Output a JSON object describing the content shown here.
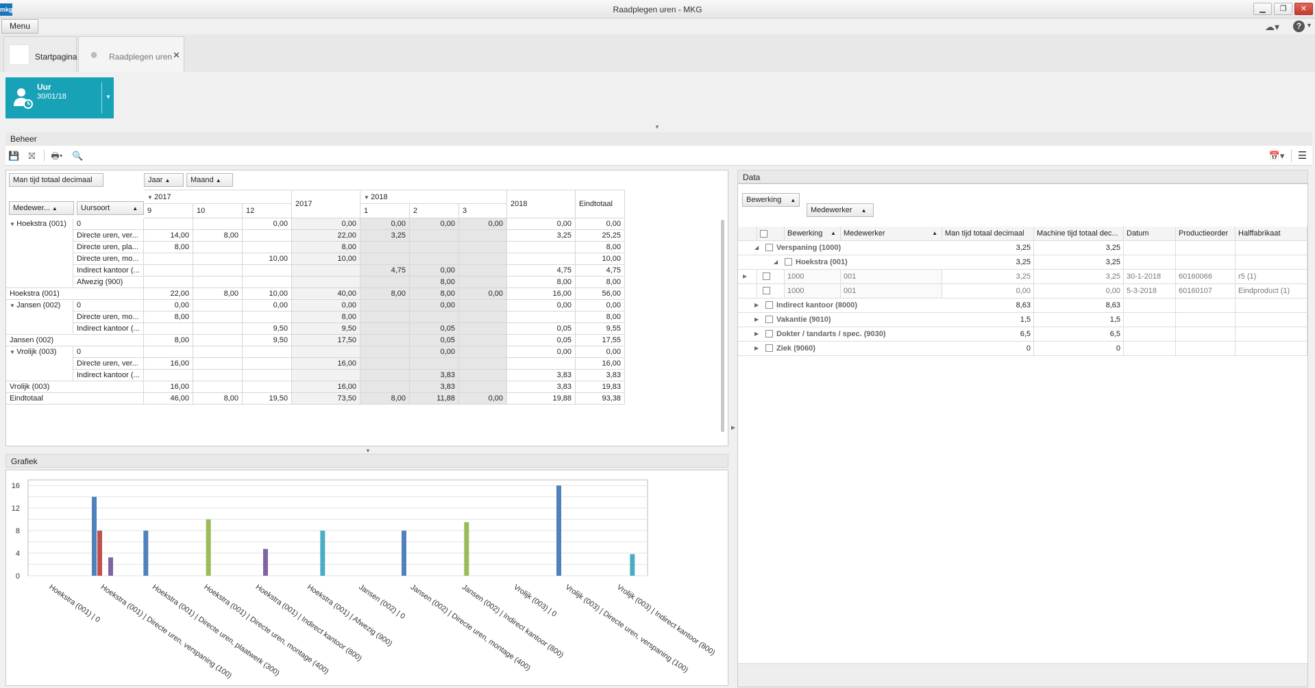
{
  "window": {
    "title": "Raadplegen uren - MKG",
    "logo": "mkg",
    "menu_label": "Menu"
  },
  "tabs": [
    {
      "label": "Startpagina",
      "closable": false
    },
    {
      "label": "Raadplegen uren",
      "closable": true
    }
  ],
  "tile": {
    "title": "Uur",
    "date": "30/01/18",
    "accent": "#17a2b8"
  },
  "beheer": {
    "title": "Beheer"
  },
  "pivot": {
    "data_field": "Man tijd totaal decimaal",
    "col_fields": [
      "Jaar",
      "Maand"
    ],
    "row_fields": [
      "Medewer...",
      "Uursoort"
    ],
    "col_headers": {
      "y2017": "2017",
      "m9": "9",
      "m10": "10",
      "m12": "12",
      "t2017": "2017",
      "y2018": "2018",
      "m1": "1",
      "m2": "2",
      "m3": "3",
      "t2018": "2018",
      "total": "Eindtotaal"
    },
    "rows": [
      {
        "group": "Hoekstra (001)",
        "type": "0",
        "v": [
          "",
          "",
          "0,00",
          "0,00",
          "0,00",
          "0,00",
          "0,00",
          "0,00",
          "0,00"
        ]
      },
      {
        "group": "",
        "type": "Directe uren, ver...",
        "v": [
          "14,00",
          "8,00",
          "",
          "22,00",
          "3,25",
          "",
          "",
          "3,25",
          "25,25"
        ]
      },
      {
        "group": "",
        "type": "Directe uren, pla...",
        "v": [
          "8,00",
          "",
          "",
          "8,00",
          "",
          "",
          "",
          "",
          "8,00"
        ]
      },
      {
        "group": "",
        "type": "Directe uren, mo...",
        "v": [
          "",
          "",
          "10,00",
          "10,00",
          "",
          "",
          "",
          "",
          "10,00"
        ]
      },
      {
        "group": "",
        "type": "Indirect kantoor (...",
        "v": [
          "",
          "",
          "",
          "",
          "4,75",
          "0,00",
          "",
          "4,75",
          "4,75"
        ]
      },
      {
        "group": "",
        "type": "Afwezig (900)",
        "v": [
          "",
          "",
          "",
          "",
          "",
          "8,00",
          "",
          "8,00",
          "8,00"
        ]
      },
      {
        "total": "Hoekstra (001)",
        "v": [
          "22,00",
          "8,00",
          "10,00",
          "40,00",
          "8,00",
          "8,00",
          "0,00",
          "16,00",
          "56,00"
        ]
      },
      {
        "group": "Jansen (002)",
        "type": "0",
        "v": [
          "0,00",
          "",
          "0,00",
          "0,00",
          "",
          "0,00",
          "",
          "0,00",
          "0,00"
        ]
      },
      {
        "group": "",
        "type": "Directe uren, mo...",
        "v": [
          "8,00",
          "",
          "",
          "8,00",
          "",
          "",
          "",
          "",
          "8,00"
        ]
      },
      {
        "group": "",
        "type": "Indirect kantoor (...",
        "v": [
          "",
          "",
          "9,50",
          "9,50",
          "",
          "0,05",
          "",
          "0,05",
          "9,55"
        ]
      },
      {
        "total": "Jansen (002)",
        "v": [
          "8,00",
          "",
          "9,50",
          "17,50",
          "",
          "0,05",
          "",
          "0,05",
          "17,55"
        ]
      },
      {
        "group": "Vrolijk (003)",
        "type": "0",
        "v": [
          "",
          "",
          "",
          "",
          "",
          "0,00",
          "",
          "0,00",
          "0,00"
        ]
      },
      {
        "group": "",
        "type": "Directe uren, ver...",
        "v": [
          "16,00",
          "",
          "",
          "16,00",
          "",
          "",
          "",
          "",
          "16,00"
        ]
      },
      {
        "group": "",
        "type": "Indirect kantoor (...",
        "v": [
          "",
          "",
          "",
          "",
          "",
          "3,83",
          "",
          "3,83",
          "3,83"
        ]
      },
      {
        "total": "Vrolijk (003)",
        "v": [
          "16,00",
          "",
          "",
          "16,00",
          "",
          "3,83",
          "",
          "3,83",
          "19,83"
        ]
      },
      {
        "total": "Eindtotaal",
        "v": [
          "46,00",
          "8,00",
          "19,50",
          "73,50",
          "8,00",
          "11,88",
          "0,00",
          "19,88",
          "93,38"
        ]
      }
    ]
  },
  "grafiek": {
    "title": "Grafiek"
  },
  "chart_data": {
    "type": "bar",
    "title": "",
    "xlabel": "",
    "ylabel": "",
    "ylim": [
      0,
      17
    ],
    "yticks": [
      0,
      4,
      8,
      12,
      16
    ],
    "grid": true,
    "categories": [
      "Hoekstra (001) | 0",
      "Hoekstra (001) | Directe uren, verspaning (100)",
      "Hoekstra (001) | Directe uren, plaatwerk (300)",
      "Hoekstra (001) | Directe uren, montage (400)",
      "Hoekstra (001) | Indirect kantoor (800)",
      "Hoekstra (001) | Afwezig (900)",
      "Jansen (002) | 0",
      "Jansen (002) | Directe uren, montage (400)",
      "Jansen (002) | Indirect kantoor (800)",
      "Vrolijk (003) | 0",
      "Vrolijk (003) | Directe uren, verspaning (100)",
      "Vrolijk (003) | Indirect kantoor (800)"
    ],
    "series": [
      {
        "color": "#4f81bd",
        "values": [
          0,
          14,
          8,
          0,
          0,
          0,
          0,
          8,
          0,
          0,
          16,
          0
        ]
      },
      {
        "color": "#c0504d",
        "values": [
          0,
          8,
          0,
          0,
          0,
          0,
          0,
          0,
          0,
          0,
          0,
          0
        ]
      },
      {
        "color": "#9bbb59",
        "values": [
          0,
          0,
          0,
          10,
          0,
          0,
          0,
          0,
          9.5,
          0,
          0,
          0
        ]
      },
      {
        "color": "#8064a2",
        "values": [
          0,
          3.25,
          0,
          0,
          4.75,
          0,
          0,
          0,
          0,
          0,
          0,
          0
        ]
      },
      {
        "color": "#4bacc6",
        "values": [
          0,
          0,
          0,
          0,
          0,
          8,
          0,
          0,
          0,
          0,
          0,
          3.83
        ]
      }
    ]
  },
  "datapanel": {
    "title": "Data",
    "group_fields": [
      "Bewerking",
      "Medewerker"
    ],
    "columns": [
      "Bewerking",
      "Medewerker",
      "Man tijd totaal decimaal",
      "Machine tijd totaal dec...",
      "Datum",
      "Productieorder",
      "Halffabrikaat"
    ],
    "groups": [
      {
        "label": "Verspaning (1000)",
        "man": "3,25",
        "mach": "3,25",
        "expanded": true
      },
      {
        "label": "Hoekstra (001)",
        "man": "3,25",
        "mach": "3,25",
        "sub": true
      },
      {
        "row": true,
        "bew": "1000",
        "med": "001",
        "man": "3,25",
        "mach": "3,25",
        "datum": "30-1-2018",
        "po": "60160066",
        "hf": "r5 (1)"
      },
      {
        "row": true,
        "bew": "1000",
        "med": "001",
        "man": "0,00",
        "mach": "0,00",
        "datum": "5-3-2018",
        "po": "60160107",
        "hf": "Eindproduct (1)"
      },
      {
        "label": "Indirect kantoor (8000)",
        "man": "8,63",
        "mach": "8,63"
      },
      {
        "label": "Vakantie (9010)",
        "man": "1,5",
        "mach": "1,5"
      },
      {
        "label": "Dokter / tandarts / spec. (9030)",
        "man": "6,5",
        "mach": "6,5"
      },
      {
        "label": "Ziek (9060)",
        "man": "0",
        "mach": "0"
      }
    ]
  }
}
